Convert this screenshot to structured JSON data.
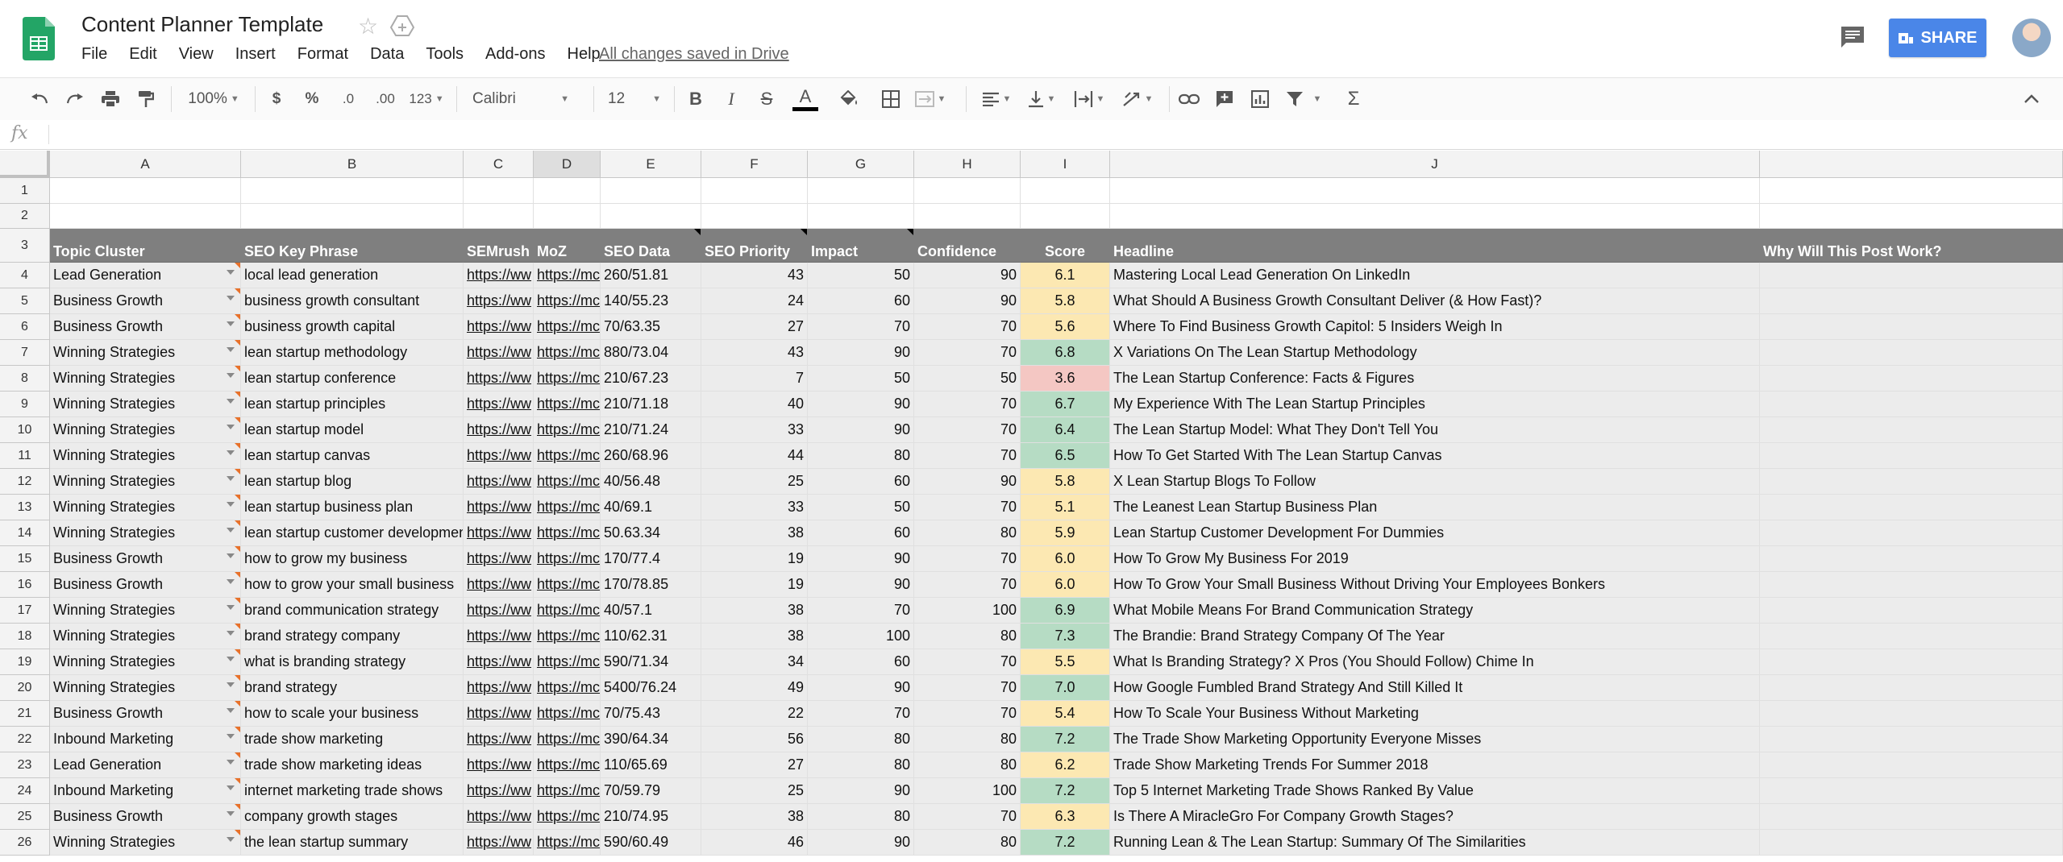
{
  "app": {
    "doc_title": "Content Planner Template",
    "saved_status": "All changes saved in Drive",
    "share_label": "SHARE",
    "menu": [
      "File",
      "Edit",
      "View",
      "Insert",
      "Format",
      "Data",
      "Tools",
      "Add-ons",
      "Help"
    ]
  },
  "toolbar": {
    "zoom": "100%",
    "currency": "$",
    "percent": "%",
    "dec_decrease": ".0",
    "dec_increase": ".00",
    "more_formats": "123",
    "font": "Calibri",
    "font_size": "12",
    "bold": "B",
    "italic": "I",
    "strike": "S",
    "text_color": "A",
    "sigma": "Σ"
  },
  "formula_bar": {
    "label": "fx",
    "value": ""
  },
  "colors": {
    "accent": "#4a86e8",
    "header_gray": "#7f7f7f",
    "row_gray": "#ececec",
    "score_green": "#b6dcc4",
    "score_yellow": "#fce8b2",
    "score_red": "#f4c7c3",
    "note_orange": "#e8712a"
  },
  "grid": {
    "columns": [
      "A",
      "B",
      "C",
      "D",
      "E",
      "F",
      "G",
      "H",
      "I",
      "J",
      ""
    ],
    "row_numbers": [
      "1",
      "2",
      "3",
      "4",
      "5",
      "6",
      "7",
      "8",
      "9",
      "10",
      "11",
      "12",
      "13",
      "14",
      "15",
      "16",
      "17",
      "18",
      "19",
      "20",
      "21",
      "22",
      "23",
      "24",
      "25",
      "26"
    ],
    "headers": [
      "Topic Cluster",
      "SEO Key Phrase",
      "SEMrush",
      "MoZ",
      "SEO Data",
      "SEO Priority",
      "Impact",
      "Confidence",
      "Score",
      "Headline",
      "Why Will This Post Work?"
    ],
    "rows": [
      {
        "topic": "Lead Generation",
        "phrase": "local lead generation",
        "semrush": "https://ww",
        "moz": "https://mc",
        "seo": "260/51.81",
        "priority": "43",
        "impact": "50",
        "confidence": "90",
        "score": "6.1",
        "headline": "Mastering Local Lead Generation On LinkedIn"
      },
      {
        "topic": "Business Growth",
        "phrase": "business growth consultant",
        "semrush": "https://ww",
        "moz": "https://mc",
        "seo": "140/55.23",
        "priority": "24",
        "impact": "60",
        "confidence": "90",
        "score": "5.8",
        "headline": "What Should A Business Growth Consultant Deliver (& How Fast)?"
      },
      {
        "topic": "Business Growth",
        "phrase": "business growth capital",
        "semrush": "https://ww",
        "moz": "https://mc",
        "seo": "70/63.35",
        "priority": "27",
        "impact": "70",
        "confidence": "70",
        "score": "5.6",
        "headline": "Where To Find Business Growth Capitol: 5 Insiders Weigh In"
      },
      {
        "topic": "Winning Strategies",
        "phrase": "lean startup methodology",
        "semrush": "https://ww",
        "moz": "https://mc",
        "seo": "880/73.04",
        "priority": "43",
        "impact": "90",
        "confidence": "70",
        "score": "6.8",
        "headline": "X Variations On The Lean Startup Methodology"
      },
      {
        "topic": "Winning Strategies",
        "phrase": "lean startup conference",
        "semrush": "https://ww",
        "moz": "https://mc",
        "seo": "210/67.23",
        "priority": "7",
        "impact": "50",
        "confidence": "50",
        "score": "3.6",
        "headline": "The Lean Startup Conference: Facts & Figures"
      },
      {
        "topic": "Winning Strategies",
        "phrase": "lean startup principles",
        "semrush": "https://ww",
        "moz": "https://mc",
        "seo": "210/71.18",
        "priority": "40",
        "impact": "90",
        "confidence": "70",
        "score": "6.7",
        "headline": "My Experience With The Lean Startup Principles"
      },
      {
        "topic": "Winning Strategies",
        "phrase": "lean startup model",
        "semrush": "https://ww",
        "moz": "https://mc",
        "seo": "210/71.24",
        "priority": "33",
        "impact": "90",
        "confidence": "70",
        "score": "6.4",
        "headline": "The Lean Startup Model: What They Don't Tell You"
      },
      {
        "topic": "Winning Strategies",
        "phrase": "lean startup canvas",
        "semrush": "https://ww",
        "moz": "https://mc",
        "seo": "260/68.96",
        "priority": "44",
        "impact": "80",
        "confidence": "70",
        "score": "6.5",
        "headline": "How To Get Started With The Lean Startup Canvas"
      },
      {
        "topic": "Winning Strategies",
        "phrase": "lean startup blog",
        "semrush": "https://ww",
        "moz": "https://mc",
        "seo": "40/56.48",
        "priority": "25",
        "impact": "60",
        "confidence": "90",
        "score": "5.8",
        "headline": "X Lean Startup Blogs To Follow"
      },
      {
        "topic": "Winning Strategies",
        "phrase": "lean startup business plan",
        "semrush": "https://ww",
        "moz": "https://mc",
        "seo": "40/69.1",
        "priority": "33",
        "impact": "50",
        "confidence": "70",
        "score": "5.1",
        "headline": "The Leanest Lean Startup Business Plan"
      },
      {
        "topic": "Winning Strategies",
        "phrase": "lean startup customer development",
        "semrush": "https://ww",
        "moz": "https://mc",
        "seo": "50.63.34",
        "priority": "38",
        "impact": "60",
        "confidence": "80",
        "score": "5.9",
        "headline": "Lean Startup Customer Development For Dummies"
      },
      {
        "topic": "Business Growth",
        "phrase": "how to grow my business",
        "semrush": "https://ww",
        "moz": "https://mc",
        "seo": "170/77.4",
        "priority": "19",
        "impact": "90",
        "confidence": "70",
        "score": "6.0",
        "headline": "How To Grow My Business For 2019"
      },
      {
        "topic": "Business Growth",
        "phrase": "how to grow your small business",
        "semrush": "https://ww",
        "moz": "https://mc",
        "seo": "170/78.85",
        "priority": "19",
        "impact": "90",
        "confidence": "70",
        "score": "6.0",
        "headline": "How To Grow Your Small Business Without Driving Your Employees Bonkers"
      },
      {
        "topic": "Winning Strategies",
        "phrase": "brand communication strategy",
        "semrush": "https://ww",
        "moz": "https://mc",
        "seo": "40/57.1",
        "priority": "38",
        "impact": "70",
        "confidence": "100",
        "score": "6.9",
        "headline": "What Mobile Means For Brand Communication Strategy"
      },
      {
        "topic": "Winning Strategies",
        "phrase": "brand strategy company",
        "semrush": "https://ww",
        "moz": "https://mc",
        "seo": "110/62.31",
        "priority": "38",
        "impact": "100",
        "confidence": "80",
        "score": "7.3",
        "headline": "The Brandie: Brand Strategy Company Of The Year"
      },
      {
        "topic": "Winning Strategies",
        "phrase": "what is branding strategy",
        "semrush": "https://ww",
        "moz": "https://mc",
        "seo": "590/71.34",
        "priority": "34",
        "impact": "60",
        "confidence": "70",
        "score": "5.5",
        "headline": "What Is Branding Strategy? X Pros (You Should Follow) Chime In"
      },
      {
        "topic": "Winning Strategies",
        "phrase": "brand strategy",
        "semrush": "https://ww",
        "moz": "https://mc",
        "seo": "5400/76.24",
        "priority": "49",
        "impact": "90",
        "confidence": "70",
        "score": "7.0",
        "headline": "How Google Fumbled Brand Strategy And Still Killed It"
      },
      {
        "topic": "Business Growth",
        "phrase": "how to scale your business",
        "semrush": "https://ww",
        "moz": "https://mc",
        "seo": "70/75.43",
        "priority": "22",
        "impact": "70",
        "confidence": "70",
        "score": "5.4",
        "headline": "How To Scale Your Business Without Marketing"
      },
      {
        "topic": "Inbound Marketing",
        "phrase": "trade show marketing",
        "semrush": "https://ww",
        "moz": "https://mc",
        "seo": "390/64.34",
        "priority": "56",
        "impact": "80",
        "confidence": "80",
        "score": "7.2",
        "headline": "The Trade Show Marketing Opportunity Everyone Misses"
      },
      {
        "topic": "Lead Generation",
        "phrase": "trade show marketing ideas",
        "semrush": "https://ww",
        "moz": "https://mc",
        "seo": "110/65.69",
        "priority": "27",
        "impact": "80",
        "confidence": "80",
        "score": "6.2",
        "headline": "Trade Show Marketing Trends For Summer 2018"
      },
      {
        "topic": "Inbound Marketing",
        "phrase": "internet marketing trade shows",
        "semrush": "https://ww",
        "moz": "https://mc",
        "seo": "70/59.79",
        "priority": "25",
        "impact": "90",
        "confidence": "100",
        "score": "7.2",
        "headline": "Top 5 Internet Marketing Trade Shows Ranked By Value"
      },
      {
        "topic": "Business Growth",
        "phrase": "company growth stages",
        "semrush": "https://ww",
        "moz": "https://mc",
        "seo": "210/74.95",
        "priority": "38",
        "impact": "80",
        "confidence": "70",
        "score": "6.3",
        "headline": "Is There A MiracleGro For Company Growth Stages?"
      },
      {
        "topic": "Winning Strategies",
        "phrase": "the lean startup summary",
        "semrush": "https://ww",
        "moz": "https://mc",
        "seo": "590/60.49",
        "priority": "46",
        "impact": "90",
        "confidence": "80",
        "score": "7.2",
        "headline": "Running Lean & The Lean Startup: Summary Of The Similarities"
      }
    ]
  }
}
